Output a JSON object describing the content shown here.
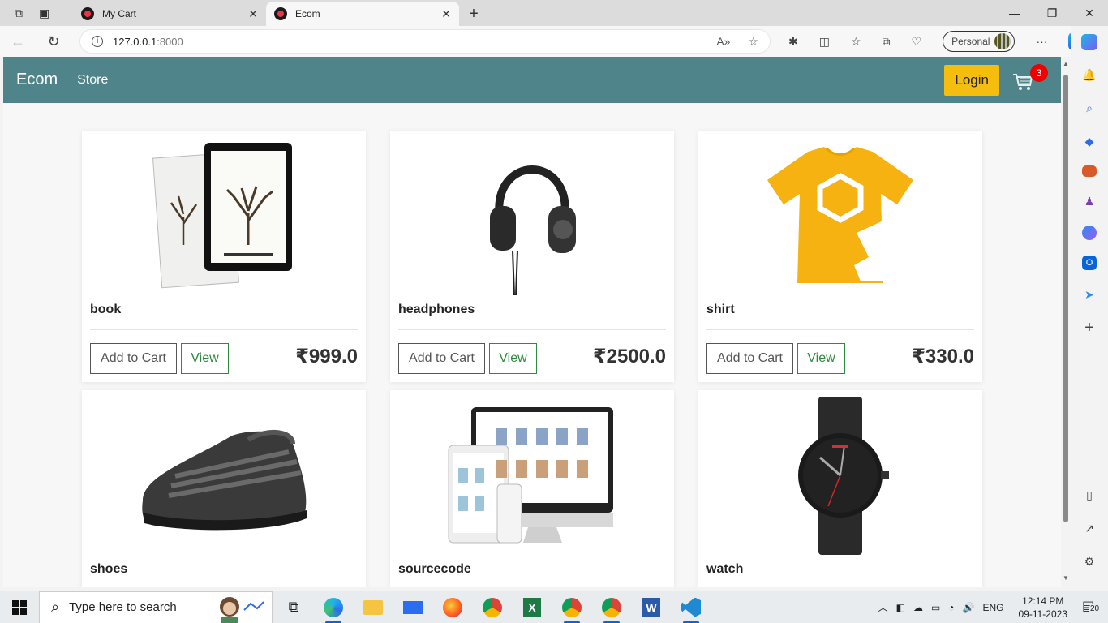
{
  "browser": {
    "tabs": [
      {
        "title": "My Cart",
        "active": false
      },
      {
        "title": "Ecom",
        "active": true
      }
    ],
    "address": {
      "host": "127.0.0.1",
      "port": ":8000"
    },
    "profile_label": "Personal"
  },
  "site": {
    "brand": "Ecom",
    "nav_link": "Store",
    "login_label": "Login",
    "cart_count": "3",
    "accent_color": "#4f858a",
    "login_color": "#f5bd0d"
  },
  "products": [
    {
      "name": "book",
      "price": "₹999.0",
      "add_label": "Add to Cart",
      "view_label": "View",
      "icon": "book-tablet-image"
    },
    {
      "name": "headphones",
      "price": "₹2500.0",
      "add_label": "Add to Cart",
      "view_label": "View",
      "icon": "headphones-image"
    },
    {
      "name": "shirt",
      "price": "₹330.0",
      "add_label": "Add to Cart",
      "view_label": "View",
      "icon": "yellow-tshirt-image"
    },
    {
      "name": "shoes",
      "icon": "black-sneaker-image"
    },
    {
      "name": "sourcecode",
      "icon": "devices-mockup-image"
    },
    {
      "name": "watch",
      "icon": "black-watch-image"
    }
  ],
  "taskbar": {
    "search_placeholder": "Type here to search",
    "language": "ENG",
    "time": "12:14 PM",
    "date": "09-11-2023",
    "notification_count": "20"
  }
}
